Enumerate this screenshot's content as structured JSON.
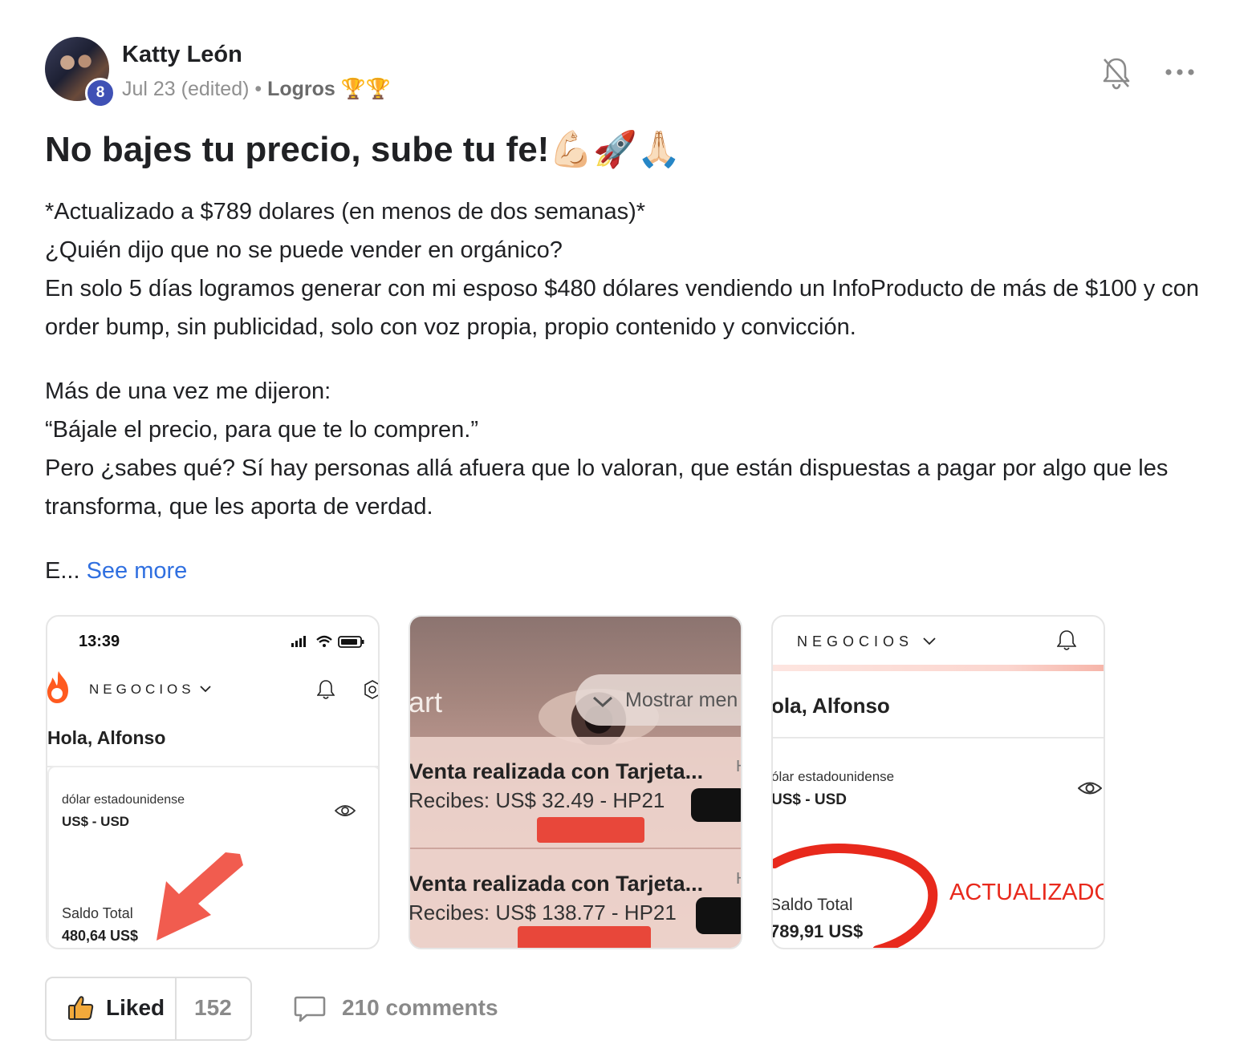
{
  "post": {
    "author": "Katty León",
    "level": "8",
    "date": "Jul 23 (edited)",
    "separator": "•",
    "category": "Logros 🏆🏆",
    "title": "No bajes tu precio, sube tu fe!💪🏻🚀🙏🏻",
    "body_lines": [
      "*Actualizado a $789 dolares (en menos de dos semanas)*",
      "¿Quién dijo que no se puede vender en orgánico?",
      "En solo 5 días logramos generar con mi esposo $480 dólares vendiendo un InfoProducto de más de $100 y con order bump, sin publicidad, solo con voz propia, propio contenido y convicción.",
      "Más de una vez me dijeron:",
      "“Bájale el precio, para que te lo compren.”",
      "Pero ¿sabes qué? Sí hay personas allá afuera que lo valoran, que están dispuestas a pagar por algo que les transforma, que les aporta de verdad."
    ],
    "truncated": "E...",
    "see_more": "See more",
    "icons": [
      "bell-off-icon",
      "more-icon",
      "thumbs-up-icon",
      "comment-icon"
    ]
  },
  "attachments": {
    "card1": {
      "time": "13:39",
      "brand": "NEGOCIOS",
      "greeting": "Hola, Alfonso",
      "currency_name": "dólar estadounidense",
      "currency_code": "US$ - USD",
      "balance_label": "Saldo Total",
      "balance": "480,64 US$"
    },
    "card2": {
      "partial_word": "art",
      "toast": "Mostrar men",
      "sale1_title": "Venta realizada con Tarjeta...",
      "sale1_detail": "Recibes: US$ 32.49 - HP21",
      "sale2_title": "Venta realizada con Tarjeta...",
      "sale2_detail": "Recibes: US$ 138.77 - HP21",
      "edge_letter": "H"
    },
    "card3": {
      "brand": "NEGOCIOS",
      "greeting": "ola, Alfonso",
      "currency_name": "ólar estadounidense",
      "currency_code": "US$ - USD",
      "balance_label": "Saldo Total",
      "balance": "789,91 US$",
      "stamp": "ACTUALIZADO"
    }
  },
  "footer": {
    "liked_label": "Liked",
    "like_count": "152",
    "comments_label": "210 comments"
  },
  "colors": {
    "link": "#2f6fe0",
    "badge": "#3f51b5",
    "brand_orange": "#ff5a1f",
    "annotation_red": "#e8473a"
  }
}
